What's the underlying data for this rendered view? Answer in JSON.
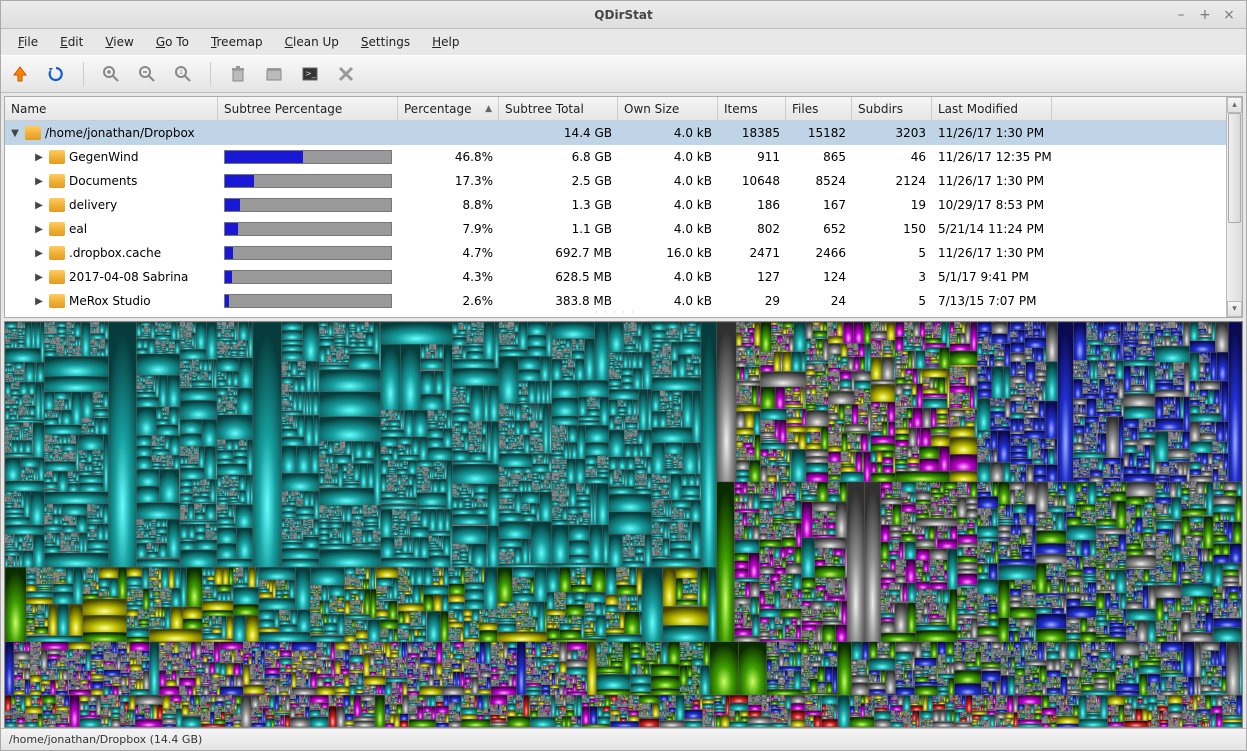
{
  "window": {
    "title": "QDirStat"
  },
  "menu": [
    {
      "label": "File",
      "hotkey": "F"
    },
    {
      "label": "Edit",
      "hotkey": "E"
    },
    {
      "label": "View",
      "hotkey": "V"
    },
    {
      "label": "Go To",
      "hotkey": "G"
    },
    {
      "label": "Treemap",
      "hotkey": "T"
    },
    {
      "label": "Clean Up",
      "hotkey": "C"
    },
    {
      "label": "Settings",
      "hotkey": "S"
    },
    {
      "label": "Help",
      "hotkey": "H"
    }
  ],
  "columns": {
    "name": "Name",
    "subperc": "Subtree Percentage",
    "perc": "Percentage",
    "subtotal": "Subtree Total",
    "own": "Own Size",
    "items": "Items",
    "files": "Files",
    "subdirs": "Subdirs",
    "lastmod": "Last Modified"
  },
  "sort_column": "Percentage",
  "root": {
    "name": "/home/jonathan/Dropbox",
    "subtotal": "14.4 GB",
    "own": "4.0 kB",
    "items": "18385",
    "files": "15182",
    "subdirs": "3203",
    "lastmod": "11/26/17 1:30 PM"
  },
  "rows": [
    {
      "name": "GegenWind",
      "perc": "46.8%",
      "bar": 46.8,
      "subtotal": "6.8 GB",
      "own": "4.0 kB",
      "items": "911",
      "files": "865",
      "subdirs": "46",
      "lastmod": "11/26/17 12:35 PM"
    },
    {
      "name": "Documents",
      "perc": "17.3%",
      "bar": 17.3,
      "subtotal": "2.5 GB",
      "own": "4.0 kB",
      "items": "10648",
      "files": "8524",
      "subdirs": "2124",
      "lastmod": "11/26/17 1:30 PM"
    },
    {
      "name": "delivery",
      "perc": "8.8%",
      "bar": 8.8,
      "subtotal": "1.3 GB",
      "own": "4.0 kB",
      "items": "186",
      "files": "167",
      "subdirs": "19",
      "lastmod": "10/29/17 8:53 PM"
    },
    {
      "name": "eal",
      "perc": "7.9%",
      "bar": 7.9,
      "subtotal": "1.1 GB",
      "own": "4.0 kB",
      "items": "802",
      "files": "652",
      "subdirs": "150",
      "lastmod": "5/21/14 11:24 PM"
    },
    {
      "name": ".dropbox.cache",
      "perc": "4.7%",
      "bar": 4.7,
      "subtotal": "692.7 MB",
      "own": "16.0 kB",
      "items": "2471",
      "files": "2466",
      "subdirs": "5",
      "lastmod": "11/26/17 1:30 PM"
    },
    {
      "name": "2017-04-08 Sabrina",
      "perc": "4.3%",
      "bar": 4.3,
      "subtotal": "628.5 MB",
      "own": "4.0 kB",
      "items": "127",
      "files": "124",
      "subdirs": "3",
      "lastmod": "5/1/17 9:41 PM"
    },
    {
      "name": "MeRox Studio",
      "perc": "2.6%",
      "bar": 2.6,
      "subtotal": "383.8 MB",
      "own": "4.0 kB",
      "items": "29",
      "files": "24",
      "subdirs": "5",
      "lastmod": "7/13/15 7:07 PM"
    }
  ],
  "statusbar": "/home/jonathan/Dropbox  (14.4 GB)",
  "icons": {
    "up": "up-arrow-icon",
    "refresh": "refresh-icon",
    "zoom_in": "zoom-in-icon",
    "zoom_out": "zoom-out-icon",
    "zoom_reset": "zoom-reset-icon",
    "trash": "trash-icon",
    "archive": "archive-icon",
    "terminal": "terminal-icon",
    "delete": "delete-icon"
  }
}
